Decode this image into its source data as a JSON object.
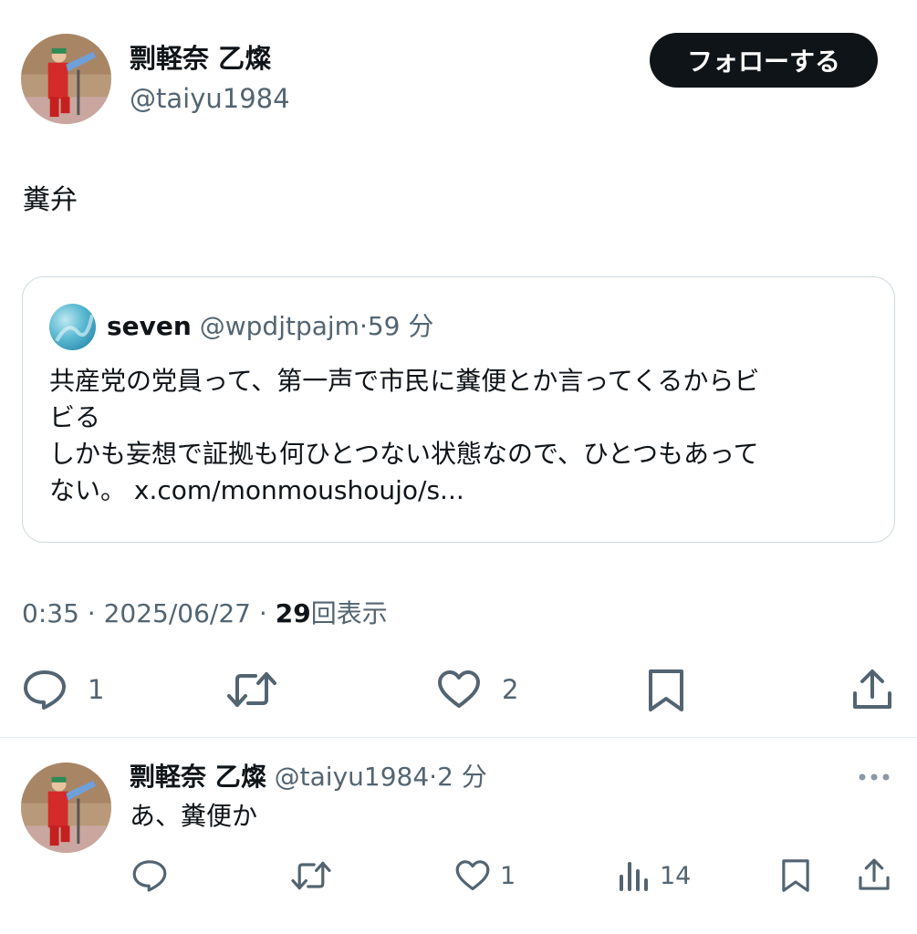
{
  "tweet": {
    "author_name": "剽軽奈 乙燦",
    "author_handle": "@taiyu1984",
    "follow_label": "フォローする",
    "text": "糞弁",
    "time": "0:35",
    "date": "2025/06/27",
    "views_count": "29",
    "views_label": "回表示",
    "separator": "·",
    "actions": {
      "reply_count": "1",
      "like_count": "2"
    }
  },
  "quote": {
    "author_name": "seven",
    "author_handle": "@wpdjtpajm",
    "time": "59 分",
    "lines": [
      "共産党の党員って、第一声で市民に糞便とか言ってくるからビ",
      "ビる",
      "しかも妄想で証拠も何ひとつない状態なので、ひとつもあって",
      "ない。 x.com/monmoushoujo/s..."
    ]
  },
  "reply": {
    "author_name": "剽軽奈 乙燦",
    "author_handle": "@taiyu1984",
    "time": "2 分",
    "text": "あ、糞便か",
    "like_count": "1",
    "views_count": "14"
  },
  "icons": {
    "reply": "speech-bubble-icon",
    "retweet": "retweet-icon",
    "like": "heart-icon",
    "bookmark": "bookmark-icon",
    "share": "share-icon",
    "views": "bar-chart-icon",
    "more": "more-dots-icon"
  },
  "colors": {
    "text": "#0f1419",
    "secondary": "#536471",
    "border": "#cfd9de",
    "follow_bg": "#0f1419"
  }
}
